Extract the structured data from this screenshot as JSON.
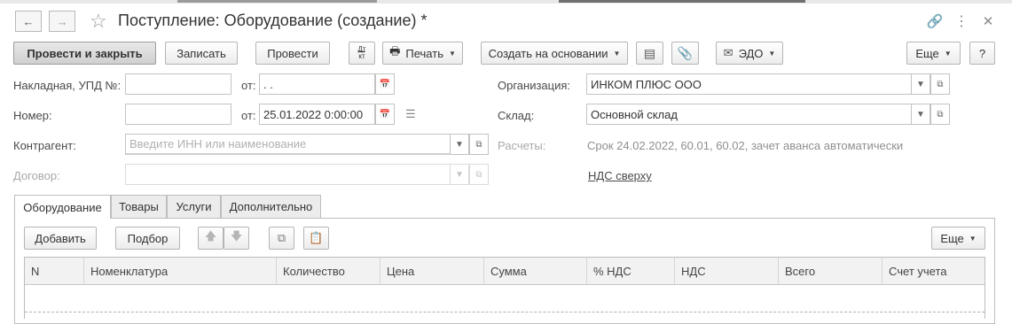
{
  "window": {
    "title": "Поступление: Оборудование (создание) *"
  },
  "toolbar": {
    "post_close": "Провести и закрыть",
    "write": "Записать",
    "post": "Провести",
    "dtkt_top": "Дт",
    "dtkt_bottom": "кт",
    "print": "Печать",
    "create_based": "Создать на основании",
    "edo": "ЭДО",
    "more": "Еще",
    "help": "?"
  },
  "form": {
    "invoice_label": "Накладная, УПД №:",
    "invoice_value": "",
    "invoice_from_label": "от:",
    "invoice_date": " .  .",
    "number_label": "Номер:",
    "number_value": "",
    "number_from_label": "от:",
    "number_date": "25.01.2022  0:00:00",
    "counterparty_label": "Контрагент:",
    "counterparty_placeholder": "Введите ИНН или наименование",
    "contract_label": "Договор:",
    "contract_value": "",
    "org_label": "Организация:",
    "org_value": "ИНКОМ ПЛЮС ООО",
    "warehouse_label": "Склад:",
    "warehouse_value": "Основной склад",
    "settlements_label": "Расчеты:",
    "settlements_value": "Срок 24.02.2022, 60.01, 60.02, зачет аванса автоматически",
    "vat_link": "НДС сверху"
  },
  "tabs": [
    {
      "label": "Оборудование",
      "active": true
    },
    {
      "label": "Товары",
      "active": false
    },
    {
      "label": "Услуги",
      "active": false
    },
    {
      "label": "Дополнительно",
      "active": false
    }
  ],
  "table_toolbar": {
    "add": "Добавить",
    "select": "Подбор",
    "more": "Еще"
  },
  "table": {
    "columns": [
      "N",
      "Номенклатура",
      "Количество",
      "Цена",
      "Сумма",
      "% НДС",
      "НДС",
      "Всего",
      "Счет учета"
    ]
  }
}
